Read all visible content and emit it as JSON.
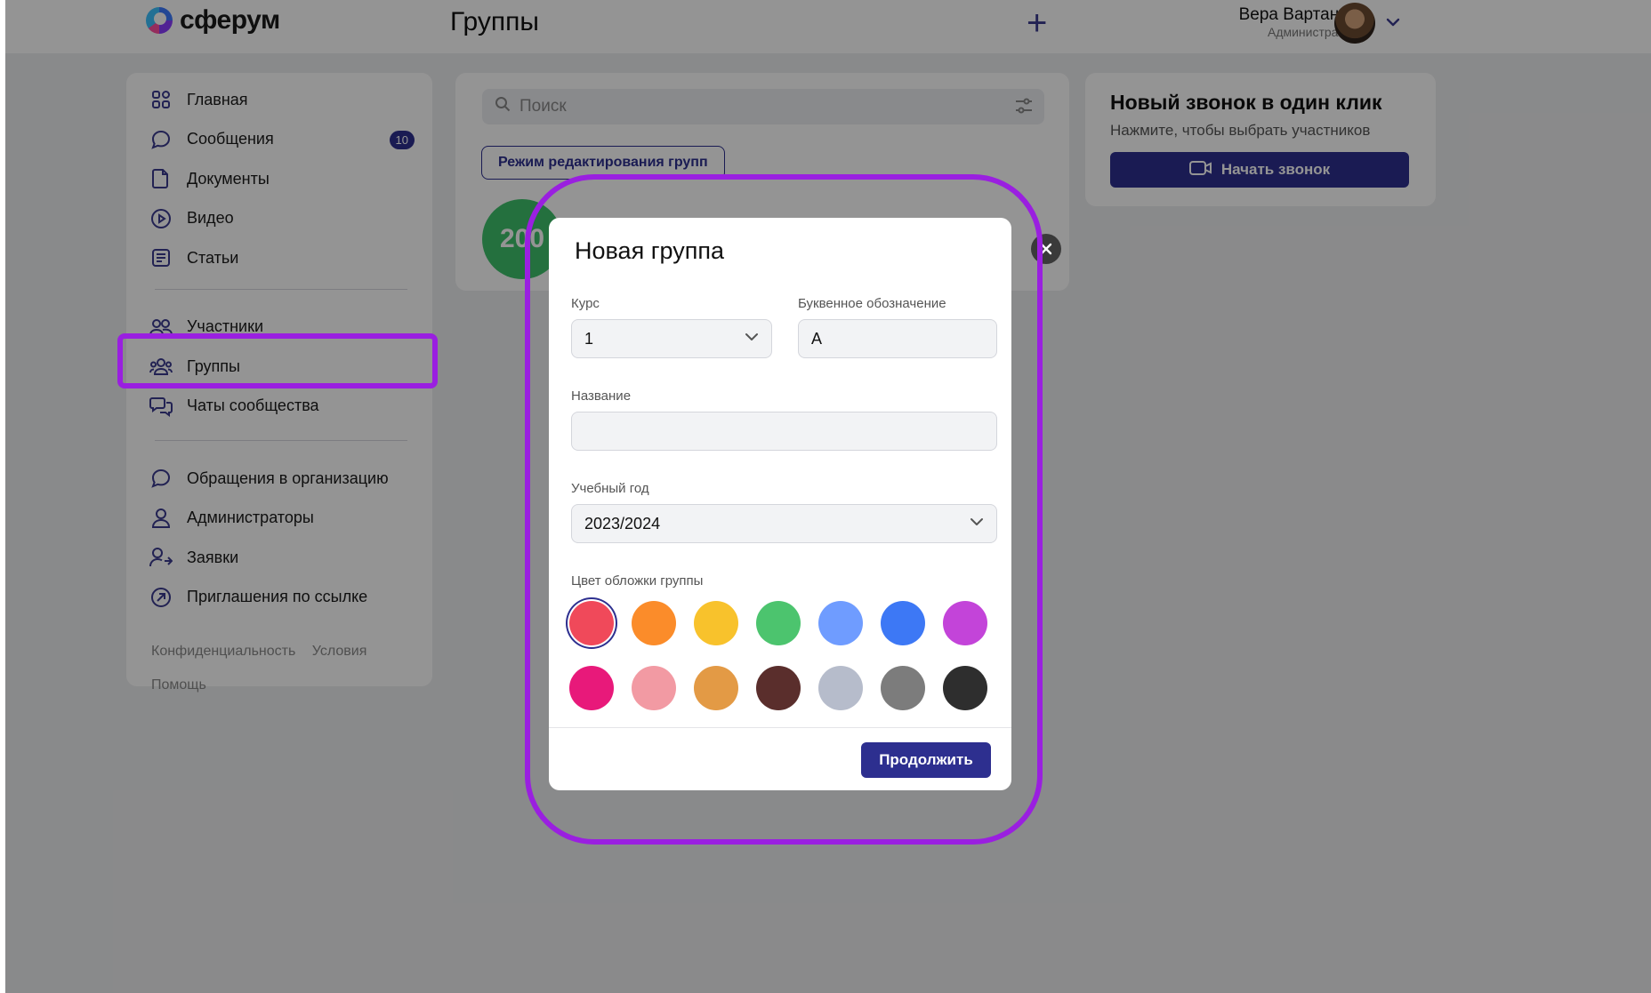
{
  "header": {
    "logo_text": "сферум",
    "page_title": "Группы",
    "add_icon": "plus-icon",
    "user_name": "Вера Вартанян",
    "user_role": "Администратор"
  },
  "sidebar": {
    "items": [
      {
        "label": "Главная",
        "icon": "grid-icon"
      },
      {
        "label": "Сообщения",
        "icon": "chat-icon",
        "badge": "10"
      },
      {
        "label": "Документы",
        "icon": "document-icon"
      },
      {
        "label": "Видео",
        "icon": "play-icon"
      },
      {
        "label": "Статьи",
        "icon": "article-icon"
      },
      {
        "label": "Участники",
        "icon": "users-icon"
      },
      {
        "label": "Группы",
        "icon": "group-icon"
      },
      {
        "label": "Чаты сообщества",
        "icon": "chats-icon"
      },
      {
        "label": "Обращения в организацию",
        "icon": "chat-icon"
      },
      {
        "label": "Администраторы",
        "icon": "user-icon"
      },
      {
        "label": "Заявки",
        "icon": "user-arrow-icon"
      },
      {
        "label": "Приглашения по ссылке",
        "icon": "link-arrow-icon"
      }
    ],
    "footer": {
      "privacy": "Конфиденциальность",
      "terms": "Условия",
      "help": "Помощь"
    }
  },
  "groups_panel": {
    "search_placeholder": "Поиск",
    "edit_mode_label": "Режим редактирования групп",
    "group_thumb_text": "200"
  },
  "call_panel": {
    "title": "Новый звонок в один клик",
    "subtitle": "Нажмите, чтобы выбрать участников",
    "button_label": "Начать звонок"
  },
  "modal": {
    "title": "Новая группа",
    "course_label": "Курс",
    "course_value": "1",
    "letter_label": "Буквенное обозначение",
    "letter_value": "А",
    "name_label": "Название",
    "name_value": "",
    "year_label": "Учебный год",
    "year_value": "2023/2024",
    "color_label": "Цвет обложки группы",
    "colors": [
      "#f0495a",
      "#fb8c2a",
      "#f8c22c",
      "#4cc46e",
      "#6f9cff",
      "#3d78f5",
      "#c344d9",
      "#e8197a",
      "#f29aa3",
      "#e39a45",
      "#5a2e2c",
      "#b6bccb",
      "#7c7c7c",
      "#2e2e2e"
    ],
    "selected_color_index": 0,
    "continue_label": "Продолжить"
  },
  "accent_color": "#2d2f8f",
  "highlight_color": "#9a1fe0"
}
